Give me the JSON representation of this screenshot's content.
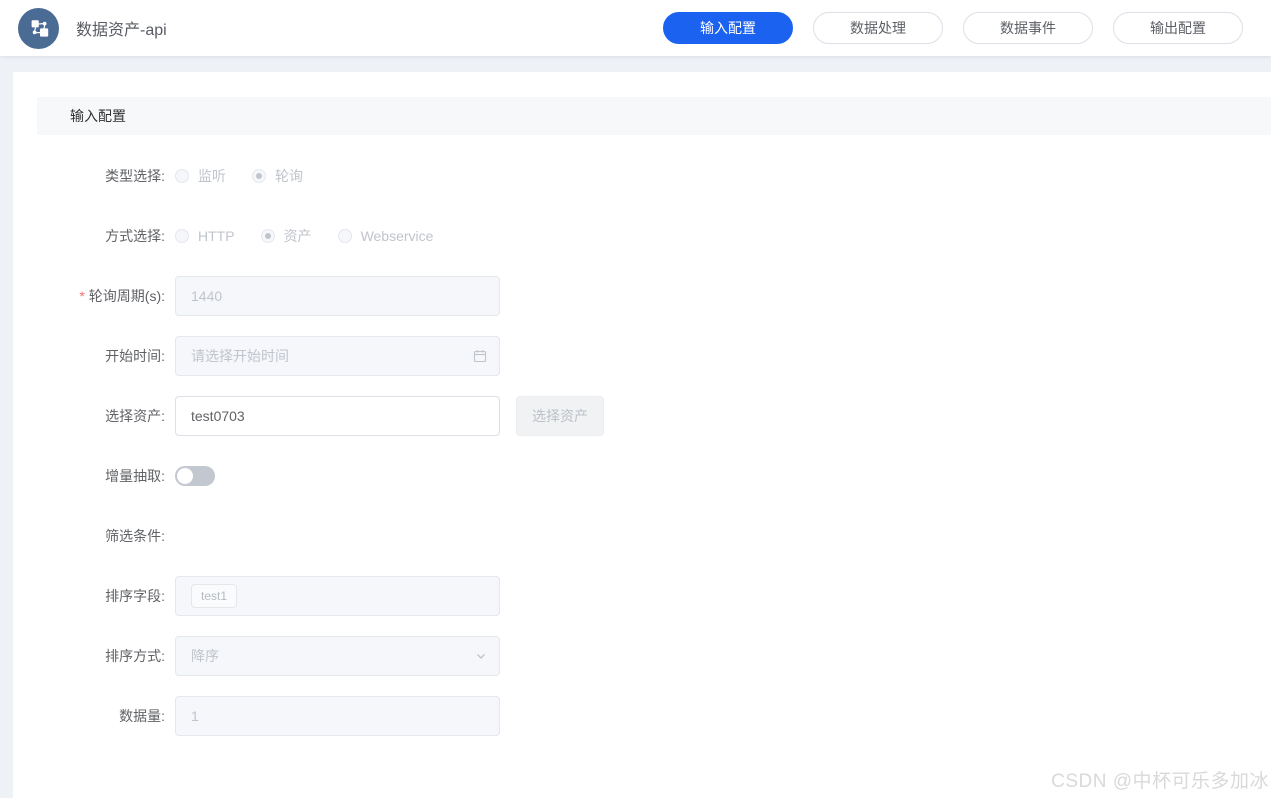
{
  "header": {
    "app_title": "数据资产-api",
    "tabs": [
      {
        "label": "输入配置",
        "active": true
      },
      {
        "label": "数据处理",
        "active": false
      },
      {
        "label": "数据事件",
        "active": false
      },
      {
        "label": "输出配置",
        "active": false
      }
    ]
  },
  "section": {
    "title": "输入配置"
  },
  "form": {
    "type_select": {
      "label": "类型选择:",
      "options": [
        {
          "label": "监听",
          "checked": false
        },
        {
          "label": "轮询",
          "checked": true
        }
      ]
    },
    "method_select": {
      "label": "方式选择:",
      "options": [
        {
          "label": "HTTP",
          "checked": false
        },
        {
          "label": "资产",
          "checked": true
        },
        {
          "label": "Webservice",
          "checked": false
        }
      ]
    },
    "poll_period": {
      "required_mark": "*",
      "label": "轮询周期(s):",
      "value": "1440",
      "disabled": true
    },
    "start_time": {
      "label": "开始时间:",
      "placeholder": "请选择开始时间",
      "disabled": true
    },
    "asset": {
      "label": "选择资产:",
      "value": "test0703",
      "button_label": "选择资产",
      "button_disabled": true
    },
    "incremental": {
      "label": "增量抽取:",
      "on": false
    },
    "filter": {
      "label": "筛选条件:"
    },
    "sort_field": {
      "label": "排序字段:",
      "tag": "test1",
      "disabled": true
    },
    "sort_order": {
      "label": "排序方式:",
      "value": "降序",
      "disabled": true
    },
    "data_count": {
      "label": "数据量:",
      "value": "1",
      "disabled": true
    }
  },
  "watermark": "CSDN @中杯可乐多加冰",
  "colors": {
    "accent": "#1c62f0",
    "logo_background": "#4a6b94",
    "required": "#f56c6c",
    "disabled_background": "#f5f7fa",
    "disabled_text": "#c0c4cc"
  }
}
